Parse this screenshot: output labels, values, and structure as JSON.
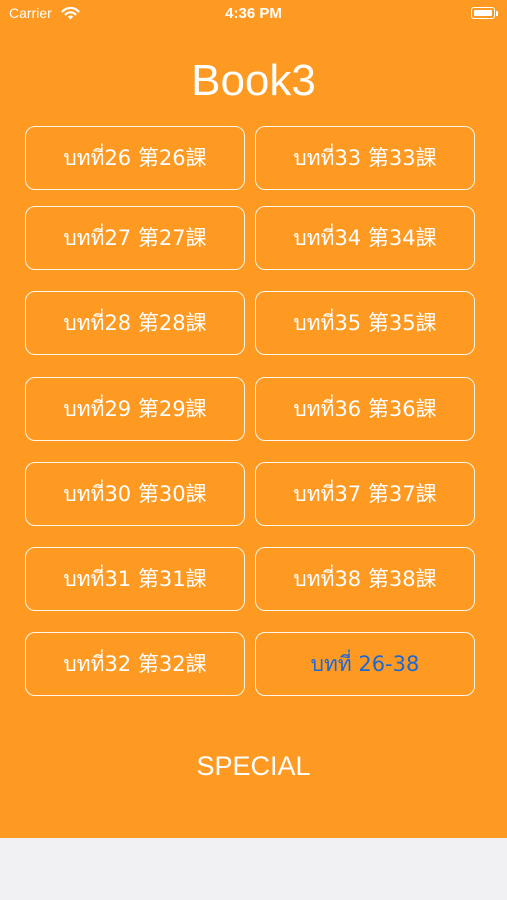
{
  "status_bar": {
    "carrier": "Carrier",
    "time": "4:36 PM"
  },
  "title": "Book3",
  "lessons_left": [
    "บทที่26 第26課",
    "บทที่27 第27課",
    "บทที่28 第28課",
    "บทที่29 第29課",
    "บทที่30 第30課",
    "บทที่31  第31課",
    "บทที่32 第32課"
  ],
  "lessons_right": [
    "บทที่33 第33課",
    "บทที่34 第34課",
    "บทที่35 第35課",
    "บทที่36 第36課",
    "บทที่37 第37課",
    "บทที่38 第38課",
    "บทที่ 26-38"
  ],
  "special_label": "SPECIAL",
  "colors": {
    "background": "#fe9a22",
    "review_button_text": "#1c68d6",
    "bottom_bar": "#f1f1f4"
  }
}
